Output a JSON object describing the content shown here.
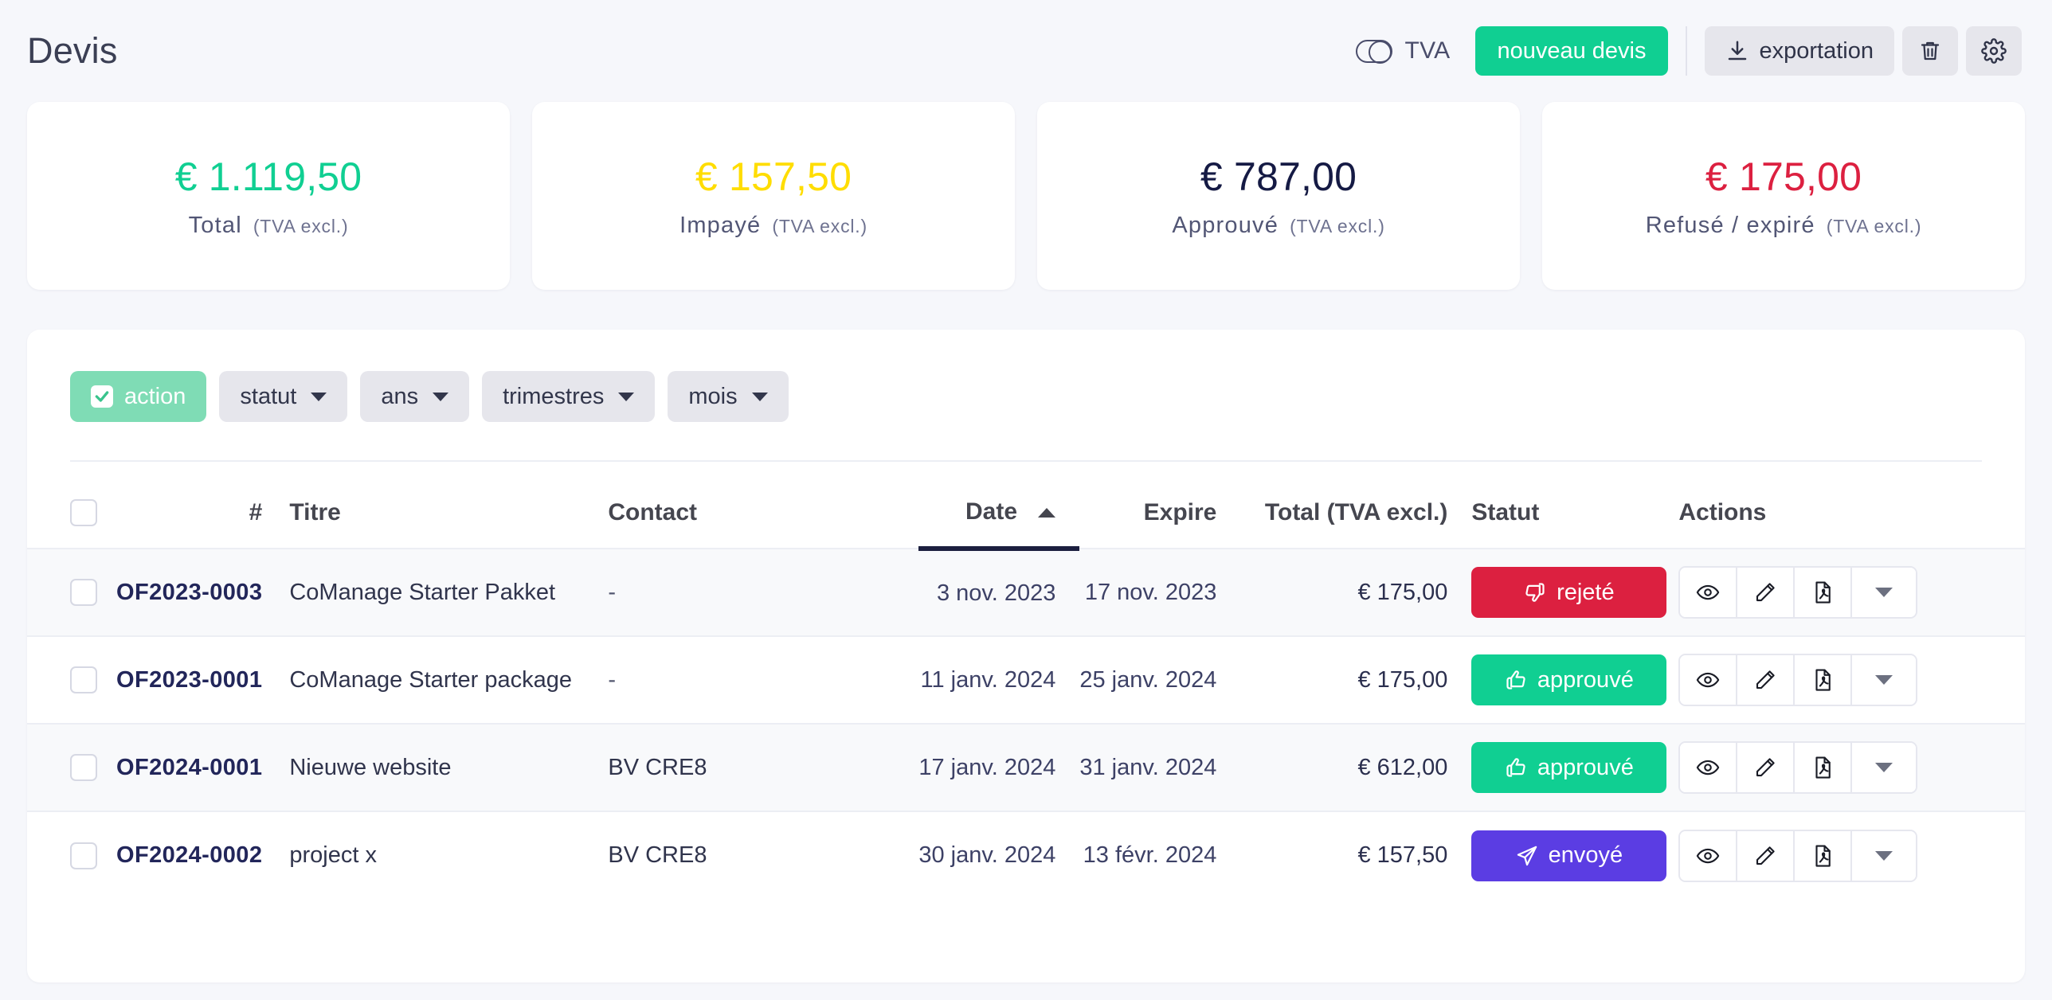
{
  "header": {
    "title": "Devis",
    "tva_toggle_label": "TVA",
    "new_quote_label": "nouveau devis",
    "export_label": "exportation",
    "delete_icon": "trash-icon",
    "settings_icon": "gear-icon"
  },
  "stats": [
    {
      "value": "€ 1.119,50",
      "label": "Total",
      "sub": "(TVA excl.)",
      "color": "#10cf92"
    },
    {
      "value": "€ 157,50",
      "label": "Impayé",
      "sub": "(TVA excl.)",
      "color": "#ffdd00"
    },
    {
      "value": "€ 787,00",
      "label": "Approuvé",
      "sub": "(TVA excl.)",
      "color": "#151a44"
    },
    {
      "value": "€ 175,00",
      "label": "Refusé / expiré",
      "sub": "(TVA excl.)",
      "color": "#dc2040"
    }
  ],
  "filters": [
    {
      "label": "action",
      "active": true,
      "caret": false,
      "check": true
    },
    {
      "label": "statut",
      "active": false,
      "caret": true,
      "check": false
    },
    {
      "label": "ans",
      "active": false,
      "caret": true,
      "check": false
    },
    {
      "label": "trimestres",
      "active": false,
      "caret": true,
      "check": false
    },
    {
      "label": "mois",
      "active": false,
      "caret": true,
      "check": false
    }
  ],
  "table": {
    "columns": {
      "num": "#",
      "title": "Titre",
      "contact": "Contact",
      "date": "Date",
      "expire": "Expire",
      "total": "Total (TVA excl.)",
      "status": "Statut",
      "actions": "Actions"
    },
    "sort": {
      "column": "Date",
      "direction": "asc"
    },
    "rows": [
      {
        "num": "OF2023-0003",
        "title": "CoManage Starter Pakket",
        "contact": "-",
        "date": "3 nov. 2023",
        "expire": "17 nov. 2023",
        "total": "€ 175,00",
        "status": "rejeté",
        "status_color": "#dc2040",
        "status_icon": "thumbs-down-icon"
      },
      {
        "num": "OF2023-0001",
        "title": "CoManage Starter package",
        "contact": "-",
        "date": "11 janv. 2024",
        "expire": "25 janv. 2024",
        "total": "€ 175,00",
        "status": "approuvé",
        "status_color": "#10cf92",
        "status_icon": "thumbs-up-icon"
      },
      {
        "num": "OF2024-0001",
        "title": "Nieuwe website",
        "contact": "BV CRE8",
        "date": "17 janv. 2024",
        "expire": "31 janv. 2024",
        "total": "€ 612,00",
        "status": "approuvé",
        "status_color": "#10cf92",
        "status_icon": "thumbs-up-icon"
      },
      {
        "num": "OF2024-0002",
        "title": "project x",
        "contact": "BV CRE8",
        "date": "30 janv. 2024",
        "expire": "13 févr. 2024",
        "total": "€ 157,50",
        "status": "envoyé",
        "status_color": "#5b3de3",
        "status_icon": "paper-plane-icon"
      }
    ],
    "row_actions": [
      "eye-icon",
      "pencil-icon",
      "pdf-icon",
      "chevron-down-icon"
    ]
  }
}
